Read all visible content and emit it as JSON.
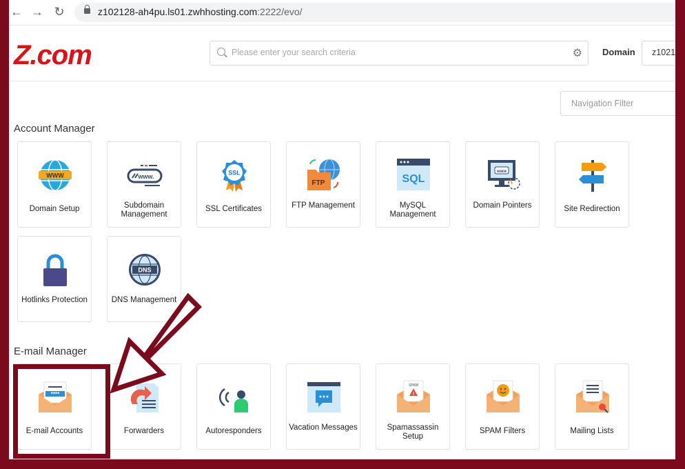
{
  "browser": {
    "back": "←",
    "forward": "→",
    "reload": "↻",
    "url_main": "z102128-ah4pu.ls01.zwhhosting.com",
    "url_rest": ":2222/evo/"
  },
  "header": {
    "logo": "Z.com",
    "search_placeholder": "Please enter your search criteria",
    "domain_label": "Domain",
    "domain_value": "z1021"
  },
  "nav_filter_placeholder": "Navigation Filter",
  "account_manager": {
    "title": "Account Manager",
    "items": [
      {
        "label": "Domain Setup",
        "icon": "globe-www-icon"
      },
      {
        "label": "Subdomain Management",
        "icon": "subdomain-icon"
      },
      {
        "label": "SSL Certificates",
        "icon": "ssl-badge-icon"
      },
      {
        "label": "FTP Management",
        "icon": "ftp-folder-icon"
      },
      {
        "label": "MySQL Management",
        "icon": "sql-icon"
      },
      {
        "label": "Domain Pointers",
        "icon": "domain-pointer-icon"
      },
      {
        "label": "Site Redirection",
        "icon": "signpost-icon"
      },
      {
        "label": "Hotlinks Protection",
        "icon": "padlock-icon"
      },
      {
        "label": "DNS Management",
        "icon": "dns-globe-icon"
      }
    ]
  },
  "email_manager": {
    "title": "E-mail Manager",
    "items": [
      {
        "label": "E-mail Accounts",
        "icon": "email-password-icon"
      },
      {
        "label": "Forwarders",
        "icon": "forward-icon"
      },
      {
        "label": "Autoresponders",
        "icon": "autoresponder-icon"
      },
      {
        "label": "Vacation Messages",
        "icon": "vacation-message-icon"
      },
      {
        "label": "Spamassassin Setup",
        "icon": "spam-envelope-icon"
      },
      {
        "label": "SPAM Filters",
        "icon": "spam-filter-icon"
      },
      {
        "label": "Mailing Lists",
        "icon": "mailing-list-icon"
      }
    ]
  },
  "colors": {
    "brand_red": "#d7141a",
    "frame": "#7a0a1c"
  }
}
